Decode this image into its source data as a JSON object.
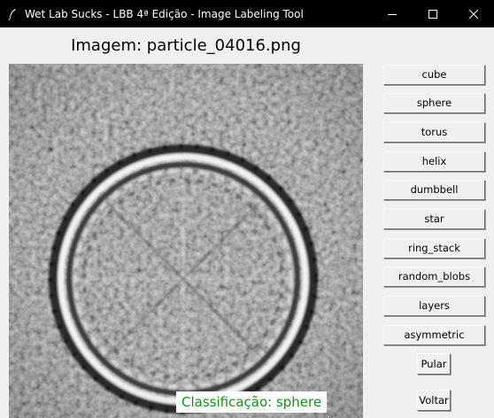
{
  "window": {
    "title": "Wet Lab Sucks - LBB 4ª Edição - Image Labeling Tool"
  },
  "image": {
    "title": "Imagem: particle_04016.png"
  },
  "classification": {
    "text": "Classificação: sphere",
    "color": "#1f8a1f"
  },
  "class_buttons": [
    "cube",
    "sphere",
    "torus",
    "helix",
    "dumbbell",
    "star",
    "ring_stack",
    "random_blobs",
    "layers",
    "asymmetric"
  ],
  "actions": {
    "skip_label": "Pular",
    "back_label": "Voltar"
  },
  "icons": {
    "app": "feather-icon",
    "minimize": "minimize-icon",
    "maximize": "maximize-icon",
    "close": "close-icon"
  }
}
